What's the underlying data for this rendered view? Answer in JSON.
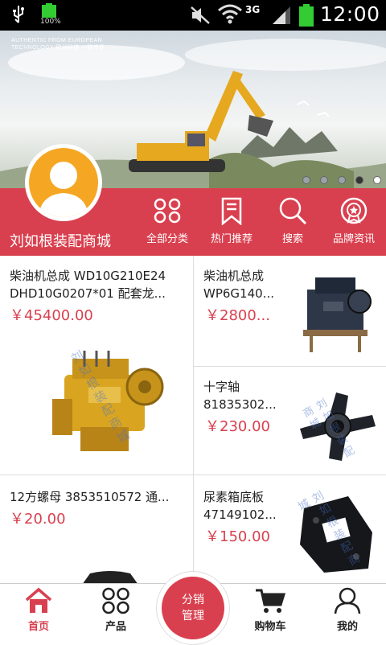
{
  "status_bar": {
    "battery_percent": "100%",
    "network": "3G",
    "time": "12:00"
  },
  "banner": {
    "tag_line1": "AUTHENTIC FROM EUROPEAN",
    "tag_line2": "TECHNOLOGY 欧洲科技 一脉传承",
    "slide_count": 5,
    "active_slide": 4
  },
  "shop": {
    "name": "刘如根装配商城",
    "nav": [
      {
        "label": "全部分类",
        "icon": "grid-icon"
      },
      {
        "label": "热门推荐",
        "icon": "bookmark-icon"
      },
      {
        "label": "搜索",
        "icon": "search-icon"
      },
      {
        "label": "品牌资讯",
        "icon": "brand-badge-icon"
      }
    ]
  },
  "products": [
    {
      "title": "柴油机总成 WD10G210E24 DHD10G0207*01 配套龙...",
      "price": "￥45400.00"
    },
    {
      "title": "柴油机总成 WP6G140...",
      "price": "￥2800..."
    },
    {
      "title": "十字轴 81835302...",
      "price": "￥230.00"
    },
    {
      "title": "12方螺母 3853510572 通...",
      "price": "￥20.00"
    },
    {
      "title": "尿素箱底板 47149102...",
      "price": "￥150.00"
    }
  ],
  "watermark_text": "刘如根装配商城",
  "bottom_nav": {
    "home": "首页",
    "products": "产品",
    "center_line1": "分销",
    "center_line2": "管理",
    "cart": "购物车",
    "mine": "我的"
  },
  "colors": {
    "accent": "#d9404f",
    "avatar": "#f5a623",
    "engine": "#d9a521"
  }
}
